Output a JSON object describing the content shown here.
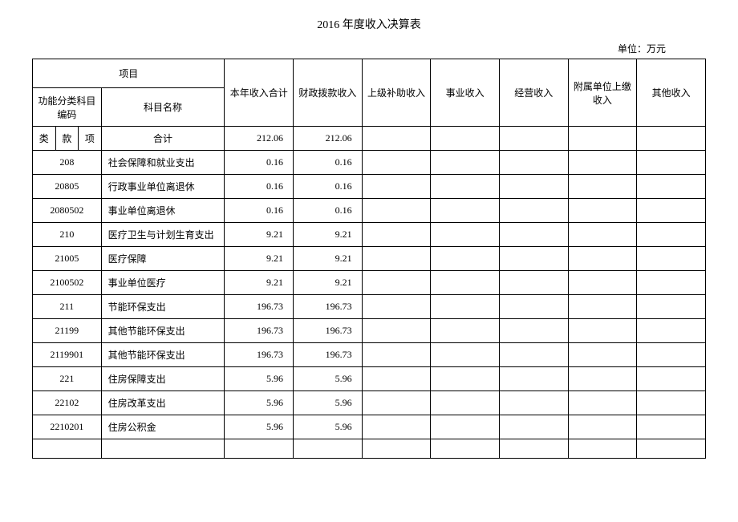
{
  "title": "2016 年度收入决算表",
  "unit_label": "单位：万元",
  "headers": {
    "project": "项目",
    "func_code": "功能分类科目编码",
    "subject_name": "科目名称",
    "income_total": "本年收入合计",
    "fiscal_income": "财政拨款收入",
    "superior_subsidy": "上级补助收入",
    "business_income": "事业收入",
    "operating_income": "经营收入",
    "affiliated_income": "附属单位上缴收入",
    "other_income": "其他收入",
    "lei": "类",
    "kuan": "款",
    "xiang": "项",
    "total": "合计"
  },
  "rows": [
    {
      "code": "",
      "name": "合计",
      "income": "212.06",
      "fiscal": "212.06",
      "is_total": true
    },
    {
      "code": "208",
      "name": "社会保障和就业支出",
      "income": "0.16",
      "fiscal": "0.16"
    },
    {
      "code": "20805",
      "name": "行政事业单位离退休",
      "income": "0.16",
      "fiscal": "0.16"
    },
    {
      "code": "2080502",
      "name": "事业单位离退休",
      "income": "0.16",
      "fiscal": "0.16"
    },
    {
      "code": "210",
      "name": "医疗卫生与计划生育支出",
      "income": "9.21",
      "fiscal": "9.21"
    },
    {
      "code": "21005",
      "name": "医疗保障",
      "income": "9.21",
      "fiscal": "9.21"
    },
    {
      "code": "2100502",
      "name": "事业单位医疗",
      "income": "9.21",
      "fiscal": "9.21"
    },
    {
      "code": "211",
      "name": "节能环保支出",
      "income": "196.73",
      "fiscal": "196.73"
    },
    {
      "code": "21199",
      "name": "其他节能环保支出",
      "income": "196.73",
      "fiscal": "196.73"
    },
    {
      "code": "2119901",
      "name": "其他节能环保支出",
      "income": "196.73",
      "fiscal": "196.73"
    },
    {
      "code": "221",
      "name": "住房保障支出",
      "income": "5.96",
      "fiscal": "5.96"
    },
    {
      "code": "22102",
      "name": "住房改革支出",
      "income": "5.96",
      "fiscal": "5.96"
    },
    {
      "code": "2210201",
      "name": "住房公积金",
      "income": "5.96",
      "fiscal": "5.96"
    },
    {
      "code": "",
      "name": "",
      "income": "",
      "fiscal": "",
      "empty": true
    }
  ]
}
